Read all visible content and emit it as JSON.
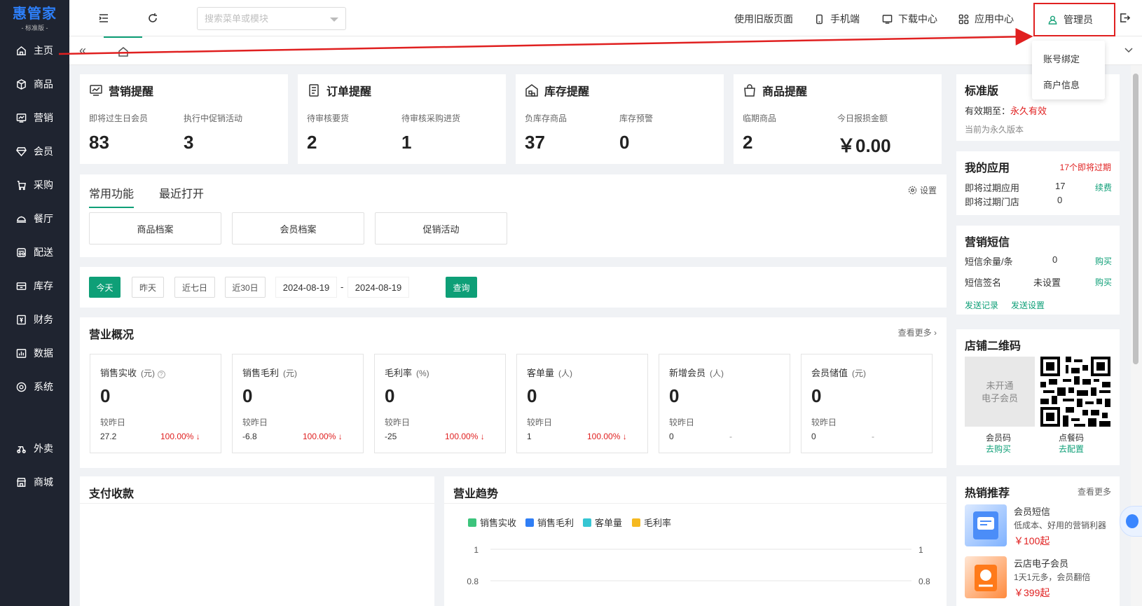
{
  "app": {
    "brand": "惠管家",
    "edition": "- 标准版 -"
  },
  "sidebar": {
    "items": [
      {
        "label": "主页",
        "icon": "home-icon"
      },
      {
        "label": "商品",
        "icon": "box-icon"
      },
      {
        "label": "营销",
        "icon": "chart-screen-icon"
      },
      {
        "label": "会员",
        "icon": "diamond-icon"
      },
      {
        "label": "采购",
        "icon": "cart-icon"
      },
      {
        "label": "餐厅",
        "icon": "dish-icon"
      },
      {
        "label": "配送",
        "icon": "truck-icon"
      },
      {
        "label": "库存",
        "icon": "inventory-icon"
      },
      {
        "label": "财务",
        "icon": "finance-icon"
      },
      {
        "label": "数据",
        "icon": "bar-chart-icon"
      },
      {
        "label": "系统",
        "icon": "settings-circle-icon"
      },
      {
        "label": "外卖",
        "icon": "delivery-icon"
      },
      {
        "label": "商城",
        "icon": "store-icon"
      }
    ]
  },
  "topbar": {
    "search_placeholder": "搜索菜单或模块",
    "old_version": "使用旧版页面",
    "mobile": "手机端",
    "download": "下载中心",
    "apps": "应用中心",
    "admin": "管理员"
  },
  "dropdown": {
    "items": [
      "账号绑定",
      "商户信息"
    ]
  },
  "alerts": [
    {
      "title": "营销提醒",
      "icon": "monitor-chart-icon",
      "items": [
        {
          "label": "即将过生日会员",
          "value": "83"
        },
        {
          "label": "执行中促销活动",
          "value": "3"
        }
      ]
    },
    {
      "title": "订单提醒",
      "icon": "document-icon",
      "items": [
        {
          "label": "待审核要货",
          "value": "2"
        },
        {
          "label": "待审核采购进货",
          "value": "1"
        }
      ]
    },
    {
      "title": "库存提醒",
      "icon": "warehouse-icon",
      "items": [
        {
          "label": "负库存商品",
          "value": "37"
        },
        {
          "label": "库存预警",
          "value": "0"
        }
      ]
    },
    {
      "title": "商品提醒",
      "icon": "bag-icon",
      "items": [
        {
          "label": "临期商品",
          "value": "2"
        },
        {
          "label": "今日报损金额",
          "value": "￥0.00"
        }
      ]
    }
  ],
  "common": {
    "tabs": [
      "常用功能",
      "最近打开"
    ],
    "settings": "设置",
    "buttons": [
      "商品档案",
      "会员档案",
      "促销活动"
    ]
  },
  "date_filter": {
    "buttons": [
      "今天",
      "昨天",
      "近七日",
      "近30日"
    ],
    "start_date": "2024-08-19",
    "separator": "-",
    "end_date": "2024-08-19",
    "query": "查询"
  },
  "overview": {
    "title": "营业概况",
    "view_more": "查看更多 ›",
    "compare_label": "较昨日",
    "metrics": [
      {
        "label": "销售实收",
        "unit": "(元)",
        "value": "0",
        "prev": "27.2",
        "pct": "100.00% ↓",
        "help": "?"
      },
      {
        "label": "销售毛利",
        "unit": "(元)",
        "value": "0",
        "prev": "-6.8",
        "pct": "100.00% ↓"
      },
      {
        "label": "毛利率",
        "unit": "(%)",
        "value": "0",
        "prev": "-25",
        "pct": "100.00% ↓"
      },
      {
        "label": "客单量",
        "unit": "(人)",
        "value": "0",
        "prev": "1",
        "pct": "100.00% ↓"
      },
      {
        "label": "新增会员",
        "unit": "(人)",
        "value": "0",
        "prev": "0",
        "pct": "-"
      },
      {
        "label": "会员储值",
        "unit": "(元)",
        "value": "0",
        "prev": "0",
        "pct": "-"
      }
    ]
  },
  "payment": {
    "title": "支付收款"
  },
  "trend": {
    "title": "营业趋势"
  },
  "chart_data": {
    "type": "line",
    "title": "营业趋势",
    "series": [
      {
        "name": "销售实收",
        "values": []
      },
      {
        "name": "销售毛利",
        "values": []
      },
      {
        "name": "客单量",
        "values": []
      },
      {
        "name": "毛利率",
        "values": []
      }
    ],
    "colors": [
      "#3cc47c",
      "#2f7ef5",
      "#36c6d3",
      "#f5b921"
    ],
    "y_ticks_left": [
      "1",
      "0.8"
    ],
    "y_ticks_right": [
      "1",
      "0.8"
    ],
    "legend": "top-left",
    "grid": true
  },
  "right": {
    "edition": {
      "title": "标准版",
      "expiry_label": "有效期至：",
      "expiry_value": "永久有效",
      "note": "当前为永久版本"
    },
    "apps": {
      "title": "我的应用",
      "badge": "17个即将过期",
      "rows": [
        {
          "label": "即将过期应用",
          "value": "17",
          "action": "续费"
        },
        {
          "label": "即将过期门店",
          "value": "0",
          "action": ""
        }
      ]
    },
    "sms": {
      "title": "营销短信",
      "rows": [
        {
          "label": "短信余量/条",
          "value": "0",
          "action": "购买"
        },
        {
          "label": "短信签名",
          "value": "未设置",
          "action": "购买"
        }
      ],
      "links": [
        "发送记录",
        "发送设置"
      ]
    },
    "qr": {
      "title": "店铺二维码",
      "placeholder_line1": "未开通",
      "placeholder_line2": "电子会员",
      "left_label": "会员码",
      "left_action": "去购买",
      "right_label": "点餐码",
      "right_action": "去配置"
    },
    "hot": {
      "title": "热销推荐",
      "view_more": "查看更多",
      "items": [
        {
          "name": "会员短信",
          "desc": "低成本、好用的营销利器",
          "price": "￥100起"
        },
        {
          "name": "云店电子会员",
          "desc": "1天1元多，会员翻倍",
          "price": "￥399起"
        }
      ]
    }
  },
  "colors": {
    "accent": "#0e9f77",
    "sidebar": "#1f2430",
    "brand": "#2d7ff9",
    "alert": "#e02020"
  }
}
